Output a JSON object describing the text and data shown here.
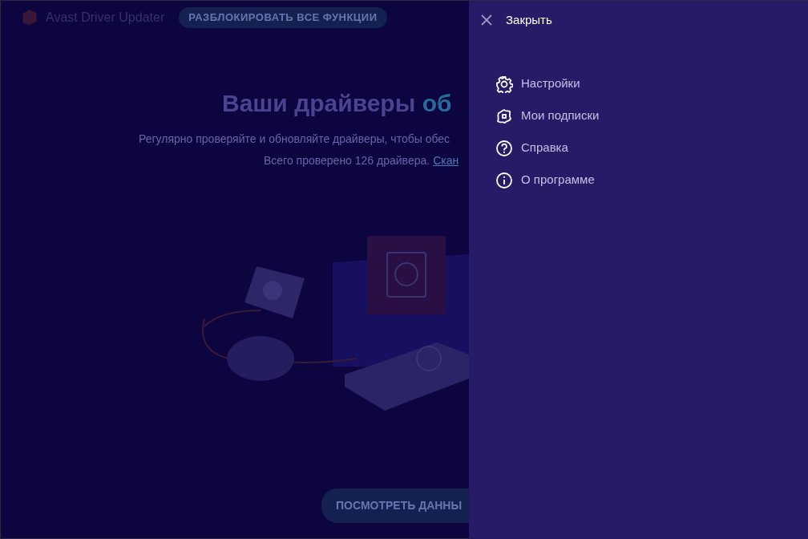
{
  "app": {
    "title": "Avast Driver Updater",
    "unlock_button": "РАЗБЛОКИРОВАТЬ ВСЕ ФУНКЦИИ"
  },
  "hero": {
    "heading": "Ваши драйверы",
    "heading_highlight": "об",
    "description": "Регулярно проверяйте и обновляйте драйверы, чтобы обес",
    "summary": "Всего проверено 126 драйвера.",
    "summary_link": "Скан",
    "action_button": "ПОСМОТРЕТЬ ДАННЫ"
  },
  "menu_panel": {
    "close_label": "Закрыть",
    "items": [
      {
        "kind": "settings",
        "label": "Настройки"
      },
      {
        "kind": "subscriptions",
        "label": "Мои подписки"
      },
      {
        "kind": "help",
        "label": "Справка"
      },
      {
        "kind": "about",
        "label": "О программе"
      }
    ]
  }
}
